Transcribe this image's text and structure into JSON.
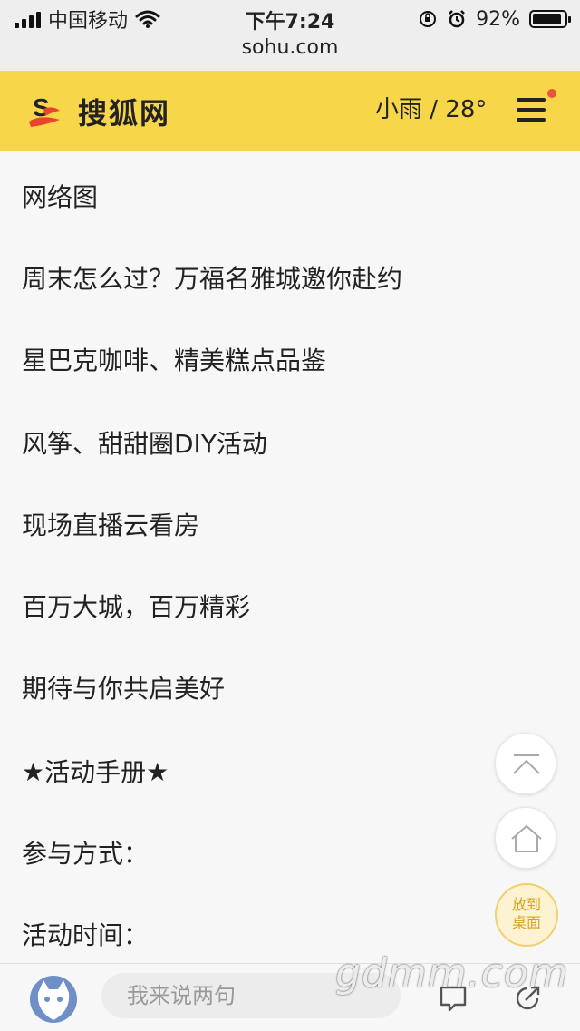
{
  "status_bar": {
    "carrier": "中国移动",
    "time": "下午7:24",
    "url": "sohu.com",
    "battery": "92%",
    "battery_level": 0.92
  },
  "header": {
    "logo_text": "搜狐网",
    "weather": "小雨 / 28°",
    "menu_icon": "hamburger-menu-icon",
    "brand_color": "#f7d64a"
  },
  "article": {
    "paragraphs": [
      "网络图",
      "周末怎么过？万福名雅城邀你赴约",
      "星巴克咖啡、精美糕点品鉴",
      "风筝、甜甜圈DIY活动",
      "现场直播云看房",
      "百万大城，百万精彩",
      "期待与你共启美好",
      "★活动手册★",
      "参与方式：",
      "活动时间："
    ]
  },
  "floating": {
    "top_icon": "back-to-top-icon",
    "home_icon": "home-icon",
    "desktop_label_1": "放到",
    "desktop_label_2": "桌面"
  },
  "bottom_bar": {
    "comment_placeholder": "我来说两句",
    "comment_icon": "comment-icon",
    "share_icon": "share-icon"
  },
  "watermark": "gdmm.com"
}
